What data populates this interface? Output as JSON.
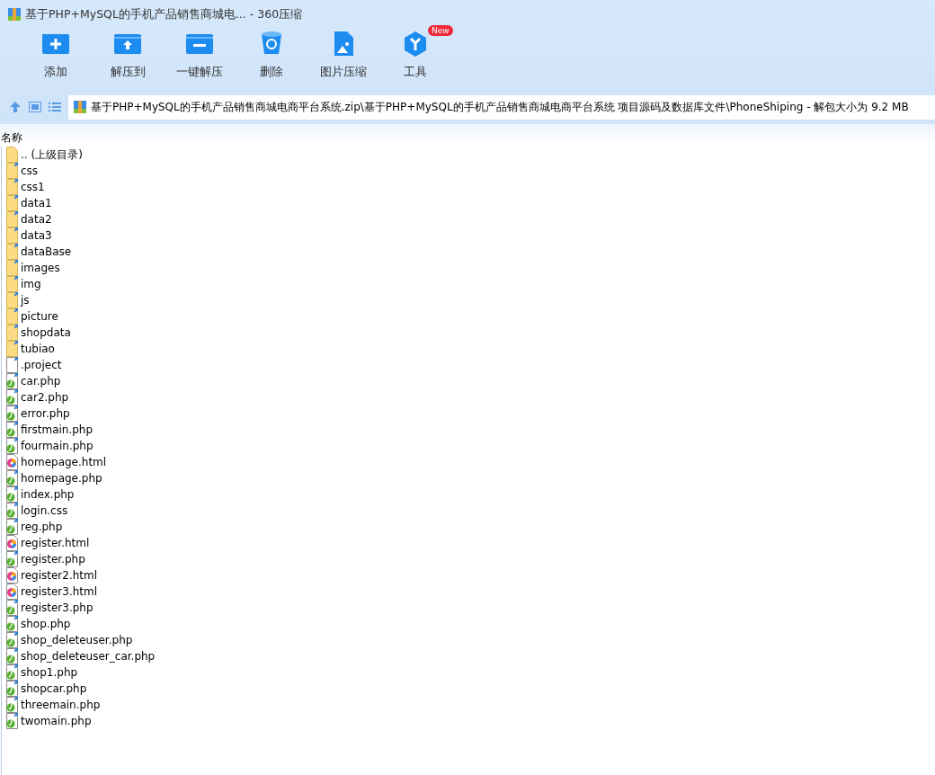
{
  "window": {
    "title": "基于PHP+MySQL的手机产品销售商城电... - 360压缩"
  },
  "toolbar": [
    {
      "kind": "add",
      "label": "添加"
    },
    {
      "kind": "extract-to",
      "label": "解压到"
    },
    {
      "kind": "extract",
      "label": "一键解压"
    },
    {
      "kind": "delete",
      "label": "删除"
    },
    {
      "kind": "image",
      "label": "图片压缩"
    },
    {
      "kind": "tools",
      "label": "工具",
      "badge": "New"
    }
  ],
  "address": {
    "path": "基于PHP+MySQL的手机产品销售商城电商平台系统.zip\\基于PHP+MySQL的手机产品销售商城电商平台系统 项目源码及数据库文件\\PhoneShiping - 解包大小为 9.2 MB"
  },
  "table": {
    "columns": [
      "名称"
    ],
    "rows": [
      {
        "kind": "parent",
        "name": ".. (上级目录)"
      },
      {
        "kind": "folder",
        "name": "css"
      },
      {
        "kind": "folder",
        "name": "css1"
      },
      {
        "kind": "folder",
        "name": "data1"
      },
      {
        "kind": "folder",
        "name": "data2"
      },
      {
        "kind": "folder",
        "name": "data3"
      },
      {
        "kind": "folder",
        "name": "dataBase"
      },
      {
        "kind": "folder",
        "name": "images"
      },
      {
        "kind": "folder",
        "name": "img"
      },
      {
        "kind": "folder",
        "name": "js"
      },
      {
        "kind": "folder",
        "name": "picture"
      },
      {
        "kind": "folder",
        "name": "shopdata"
      },
      {
        "kind": "folder",
        "name": "tubiao"
      },
      {
        "kind": "file",
        "name": ".project"
      },
      {
        "kind": "php",
        "name": "car.php"
      },
      {
        "kind": "php",
        "name": "car2.php"
      },
      {
        "kind": "php",
        "name": "error.php"
      },
      {
        "kind": "php",
        "name": "firstmain.php"
      },
      {
        "kind": "php",
        "name": "fourmain.php"
      },
      {
        "kind": "html",
        "name": "homepage.html"
      },
      {
        "kind": "php",
        "name": "homepage.php"
      },
      {
        "kind": "php",
        "name": "index.php"
      },
      {
        "kind": "php",
        "name": "login.css"
      },
      {
        "kind": "php",
        "name": "reg.php"
      },
      {
        "kind": "html",
        "name": "register.html"
      },
      {
        "kind": "php",
        "name": "register.php"
      },
      {
        "kind": "html",
        "name": "register2.html"
      },
      {
        "kind": "html",
        "name": "register3.html"
      },
      {
        "kind": "php",
        "name": "register3.php"
      },
      {
        "kind": "php",
        "name": "shop.php"
      },
      {
        "kind": "php",
        "name": "shop_deleteuser.php"
      },
      {
        "kind": "php",
        "name": "shop_deleteuser_car.php"
      },
      {
        "kind": "php",
        "name": "shop1.php"
      },
      {
        "kind": "php",
        "name": "shopcar.php"
      },
      {
        "kind": "php",
        "name": "threemain.php"
      },
      {
        "kind": "php",
        "name": "twomain.php"
      }
    ]
  }
}
